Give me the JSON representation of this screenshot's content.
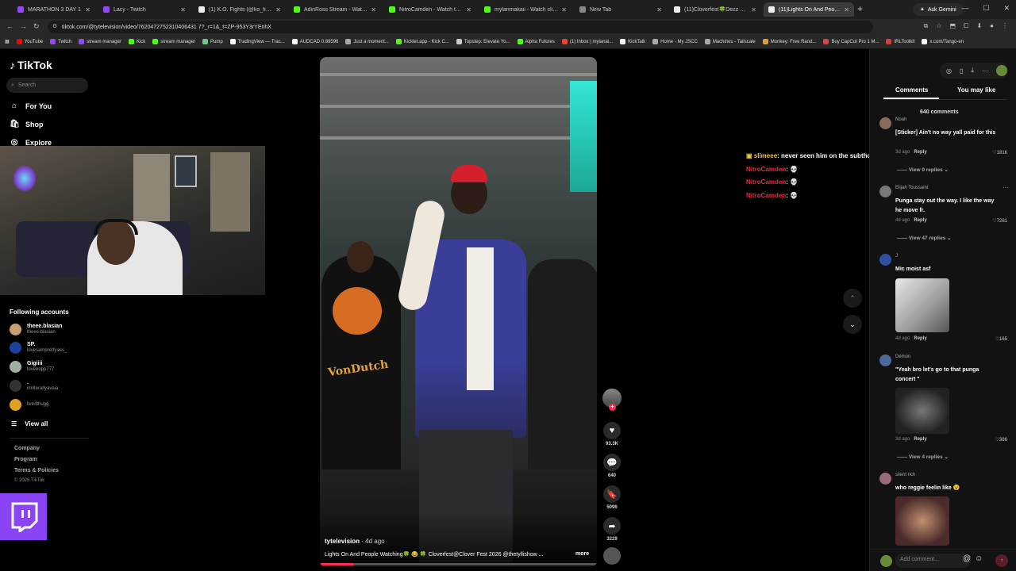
{
  "browser": {
    "tabs": [
      {
        "label": "MARATHON 3 DAY 1",
        "color": "#9147ff"
      },
      {
        "label": "Lacy - Twitch",
        "color": "#9147ff"
      },
      {
        "label": "(1) K.O. Fights (@ko_fights_) / X",
        "color": "#eeeeee"
      },
      {
        "label": "AdinRoss Stream - Watch Live",
        "color": "#53fc18"
      },
      {
        "label": "NitroCamden - Watch the VOD",
        "color": "#53fc18"
      },
      {
        "label": "mylanmakaii - Watch clips on",
        "color": "#53fc18"
      },
      {
        "label": "New Tab",
        "color": "#888888"
      },
      {
        "label": "(11)Cloverfest🍀Dezz perfo",
        "color": "#eeeeee"
      },
      {
        "label": "(11)Lights On And People W",
        "color": "#eeeeee"
      }
    ],
    "active_tab": 8,
    "new_tab": "+",
    "gemini": "Ask Gemini",
    "url": "tiktok.com/@tytelevision/video/7620472752310406431 7?_r=1&_t=ZP-953Y3rYEnhX",
    "bookmarks": [
      {
        "label": "YouTube",
        "color": "#ff0000"
      },
      {
        "label": "Twitch",
        "color": "#9147ff"
      },
      {
        "label": "stream manager",
        "color": "#9147ff"
      },
      {
        "label": "Kick",
        "color": "#53fc18"
      },
      {
        "label": "stream manager",
        "color": "#53fc18"
      },
      {
        "label": "Pump",
        "color": "#66cc88"
      },
      {
        "label": "TradingView — Trac...",
        "color": "#ffffff"
      },
      {
        "label": "AUDCAD 0.89596",
        "color": "#ffffff"
      },
      {
        "label": "Just a moment...",
        "color": "#aaaaaa"
      },
      {
        "label": "Kicklet.app - Kick C...",
        "color": "#53fc18"
      },
      {
        "label": "Topstep: Elevate Yo...",
        "color": "#cccccc"
      },
      {
        "label": "Alpha Futures",
        "color": "#53fc18"
      },
      {
        "label": "(1) Inbox | mylanai...",
        "color": "#ea4335"
      },
      {
        "label": "KickTalk",
        "color": "#ffffff"
      },
      {
        "label": "Home - My JSCC",
        "color": "#aaaaaa"
      },
      {
        "label": "Machines - Tailscale",
        "color": "#aaaaaa"
      },
      {
        "label": "Monkey: Free Rand...",
        "color": "#e0a030"
      },
      {
        "label": "Buy CapCut Pro 1 M...",
        "color": "#e04040"
      },
      {
        "label": "IRLToolkit",
        "color": "#d04040"
      },
      {
        "label": "x.com/Tango‑en",
        "color": "#ffffff"
      }
    ]
  },
  "sidebar": {
    "logo": "TikTok",
    "search_placeholder": "Search",
    "nav": [
      {
        "label": "For You",
        "icon": "home-icon"
      },
      {
        "label": "Shop",
        "icon": "shop-icon"
      },
      {
        "label": "Explore",
        "icon": "explore-icon"
      }
    ],
    "following_title": "Following accounts",
    "following": [
      {
        "name": "theee.blasian",
        "handle": "theee.blasian",
        "color": "#c8a070"
      },
      {
        "name": "SP.",
        "handle": "lovesampretty ass_",
        "color": "#2040a0"
      },
      {
        "name": "Gigiiii",
        "handle": "loveeopp777",
        "color": "#a0b0a0"
      },
      {
        "name": ".",
        "handle": "imliterallyavaia",
        "color": "#333333"
      },
      {
        "name": "",
        "handle": "live4thugg",
        "color": "#e0a020"
      }
    ],
    "view_all": "View all",
    "footer": [
      "Company",
      "Program",
      "Terms & Policies"
    ],
    "copyright": "© 2026 TikTok"
  },
  "video": {
    "author": "tytelevision",
    "ago": " · 4d ago",
    "caption": "Lights On And People Watching🍀 😂 🍀 Cloverfest@Clover Fest 2026 @thetyllishow ...",
    "more": "more",
    "progress": 0.12,
    "overlay_text": "VonDutch"
  },
  "actions": {
    "likes": "93.3K",
    "comments": "640",
    "saves": "5096",
    "shares": "3229"
  },
  "chat_overlay": [
    {
      "user": "slimeee",
      "msg": ": never seen him on the subthon",
      "gold": true
    },
    {
      "user": "NitroCamden",
      "msg": ": 💀",
      "gold": false
    },
    {
      "user": "NitroCamden",
      "msg": ": 💀",
      "gold": false
    },
    {
      "user": "NitroCamden",
      "msg": ": 💀",
      "gold": false
    }
  ],
  "right_panel": {
    "tab_comments": "Comments",
    "tab_may_like": "You may like",
    "comment_count": "640 comments",
    "comments": [
      {
        "name": "Noah",
        "text": "[Sticker] Ain't no way yall paid for this",
        "date": "3d ago",
        "reply": "Reply",
        "likes": "1816",
        "replies": "View 9 replies",
        "color": "#8a6a5a"
      },
      {
        "name": "Elijah Toussaint",
        "text": "Punga stay out the way. I like the way he move fr.",
        "date": "4d ago",
        "reply": "Reply",
        "likes": "7261",
        "replies": "View 47 replies",
        "color": "#777777"
      },
      {
        "name": "J",
        "text": "Mic moist asf",
        "date": "4d ago",
        "reply": "Reply",
        "likes": "165",
        "replies": "",
        "color": "#3050a0"
      },
      {
        "name": "Demon",
        "text": "\"Yeah bro let's go to that punga concert \"",
        "date": "3d ago",
        "reply": "Reply",
        "likes": "386",
        "replies": "View 4 replies",
        "color": "#4a6a9a"
      },
      {
        "name": "silent rich",
        "text": "who reggie feelin like 😵",
        "date": "",
        "reply": "",
        "likes": "",
        "replies": "",
        "color": "#9a6a7a"
      }
    ],
    "add_comment_placeholder": "Add comment..."
  },
  "colors": {
    "accent": "#fe2c55",
    "twitch": "#8a44f5",
    "chat_user": "#e0303c"
  }
}
